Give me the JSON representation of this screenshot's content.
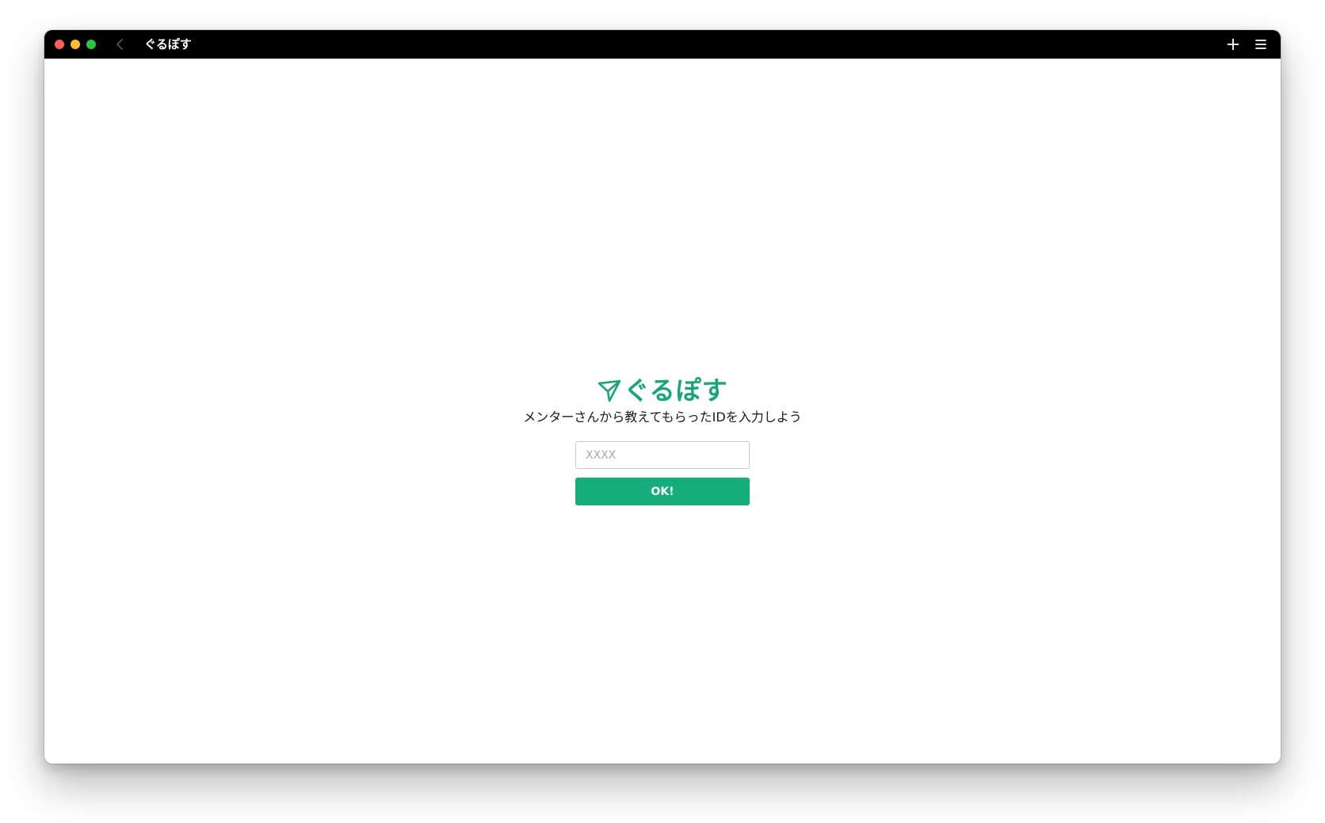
{
  "window": {
    "title": "ぐるぽす"
  },
  "titlebar": {
    "icons": [
      "close-icon",
      "minimize-icon",
      "maximize-icon",
      "chevron-left-icon",
      "plus-icon",
      "hamburger-menu-icon"
    ]
  },
  "app": {
    "brand_name": "ぐるぽす",
    "brand_icon": "paper-plane-icon",
    "subtitle": "メンターさんから教えてもらったIDを入力しよう",
    "id_input": {
      "placeholder": "XXXX",
      "value": ""
    },
    "ok_label": "OK!",
    "accent_color": "#15ad79"
  }
}
